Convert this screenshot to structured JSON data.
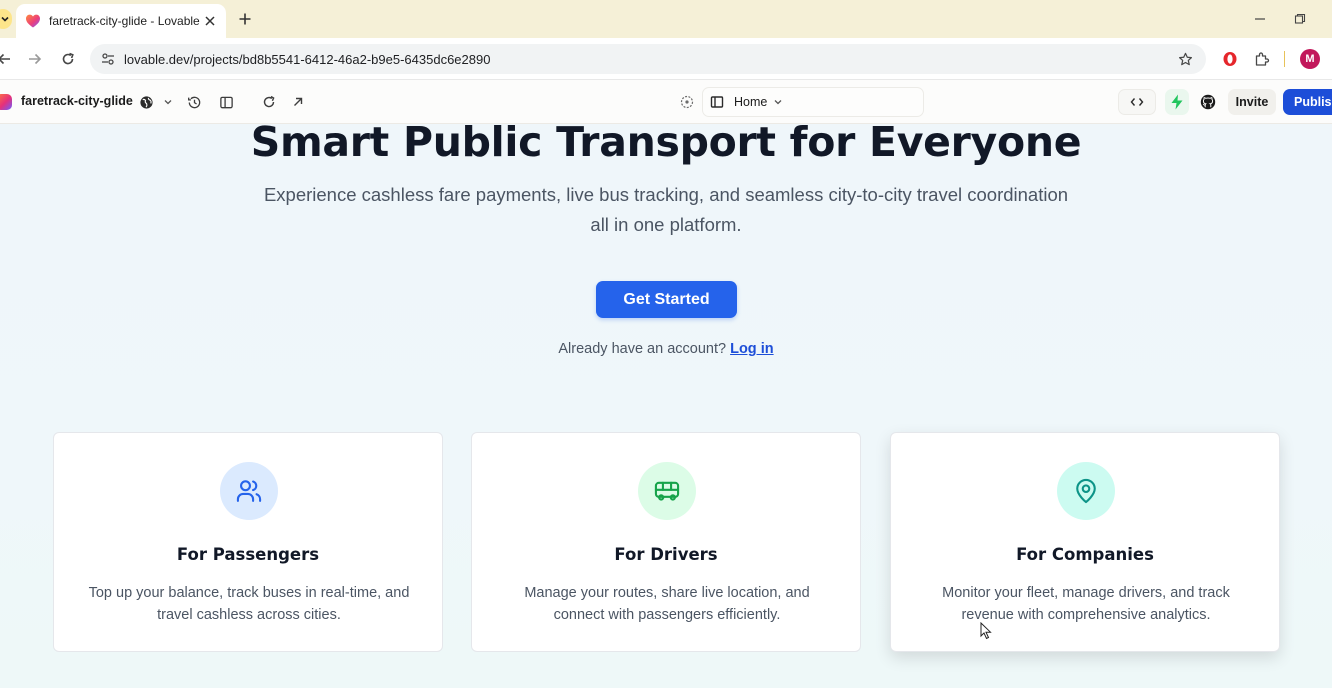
{
  "browser": {
    "tab_title": "faretrack-city-glide - Lovable",
    "url": "lovable.dev/projects/bd8b5541-6412-46a2-b9e5-6435dc6e2890",
    "profile_initial": "M"
  },
  "project_bar": {
    "project_name": "faretrack-city-glide",
    "route_label": "Home",
    "invite_label": "Invite",
    "publish_label": "Publish"
  },
  "hero": {
    "title": "Smart Public Transport for Everyone",
    "subtitle": "Experience cashless fare payments, live bus tracking, and seamless city-to-city travel coordination all in one platform.",
    "cta_label": "Get Started",
    "login_prompt": "Already have an account?",
    "login_link": "Log in"
  },
  "cards": [
    {
      "title": "For Passengers",
      "description": "Top up your balance, track buses in real-time, and travel cashless across cities.",
      "icon": "users-icon",
      "icon_color": "#2563eb",
      "icon_bg": "#dbeafe"
    },
    {
      "title": "For Drivers",
      "description": "Manage your routes, share live location, and connect with passengers efficiently.",
      "icon": "bus-icon",
      "icon_color": "#16a34a",
      "icon_bg": "#dcfce7"
    },
    {
      "title": "For Companies",
      "description": "Monitor your fleet, manage drivers, and track revenue with comprehensive analytics.",
      "icon": "map-pin-icon",
      "icon_color": "#0d9488",
      "icon_bg": "#ccfbf1"
    }
  ],
  "colors": {
    "primary": "#2563eb",
    "publish": "#1d4ed8",
    "lightning": "#22c55e",
    "tab_strip": "#f5f0d7"
  }
}
